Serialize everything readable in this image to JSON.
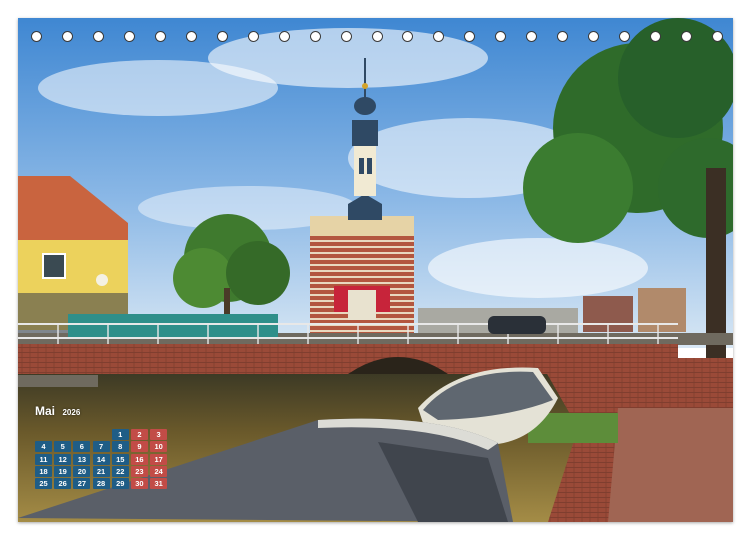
{
  "calendar": {
    "month": "Mai",
    "year": "2026",
    "weeks": [
      [
        "",
        "",
        "",
        "",
        "1",
        "2",
        "3"
      ],
      [
        "4",
        "5",
        "6",
        "7",
        "8",
        "9",
        "10"
      ],
      [
        "11",
        "12",
        "13",
        "14",
        "15",
        "16",
        "17"
      ],
      [
        "18",
        "19",
        "20",
        "21",
        "22",
        "23",
        "24"
      ],
      [
        "25",
        "26",
        "27",
        "28",
        "29",
        "30",
        "31"
      ]
    ],
    "weekday_color": "#1f5d86",
    "weekend_color": "#c24c47"
  },
  "binding": {
    "hole_count": 23
  },
  "colors": {
    "sky": "#5c9ad6",
    "canal": "#5c4e2a",
    "brick": "#a3553f"
  }
}
